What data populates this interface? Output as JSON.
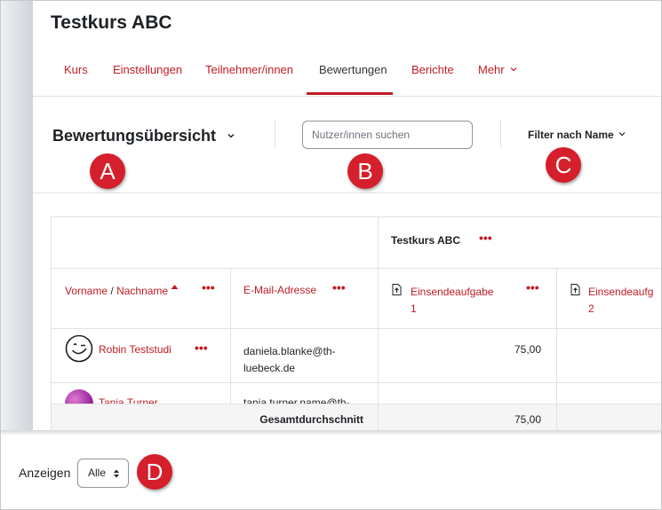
{
  "course": {
    "title": "Testkurs ABC"
  },
  "nav": {
    "tabs": [
      {
        "label": "Kurs"
      },
      {
        "label": "Einstellungen"
      },
      {
        "label": "Teilnehmer/innen"
      },
      {
        "label": "Bewertungen"
      },
      {
        "label": "Berichte"
      },
      {
        "label": "Mehr"
      }
    ],
    "active_tab": "Bewertungen"
  },
  "report": {
    "title": "Bewertungsübersicht",
    "search_placeholder": "Nutzer/innen suchen",
    "filter_label": "Filter nach Name"
  },
  "callouts": {
    "a": "A",
    "b": "B",
    "c": "C",
    "d": "D"
  },
  "table": {
    "category": "Testkurs ABC",
    "col_name_first": "Vorname",
    "col_name_sep": "/",
    "col_name_last": "Nachname",
    "col_email": "E-Mail-Adresse",
    "items": [
      {
        "line1": "Einsendeaufgabe",
        "line2": "1"
      },
      {
        "line1": "Einsendeaufg",
        "line2": "2"
      }
    ],
    "rows": [
      {
        "name": "Robin Teststudi",
        "email_line1": "daniela.blanke@th-",
        "email_line2": "luebeck.de",
        "grade1": "75,00"
      },
      {
        "name": "Tanja Turner",
        "email_line1": "tanja.turner.name@th-"
      }
    ],
    "overall_label": "Gesamtdurchschnitt",
    "overall_value": "75,00",
    "more_glyph": "•••"
  },
  "footer": {
    "show_label": "Anzeigen",
    "show_value": "Alle"
  },
  "colors": {
    "accent": "#c11c25",
    "badge": "#d51f2c"
  }
}
